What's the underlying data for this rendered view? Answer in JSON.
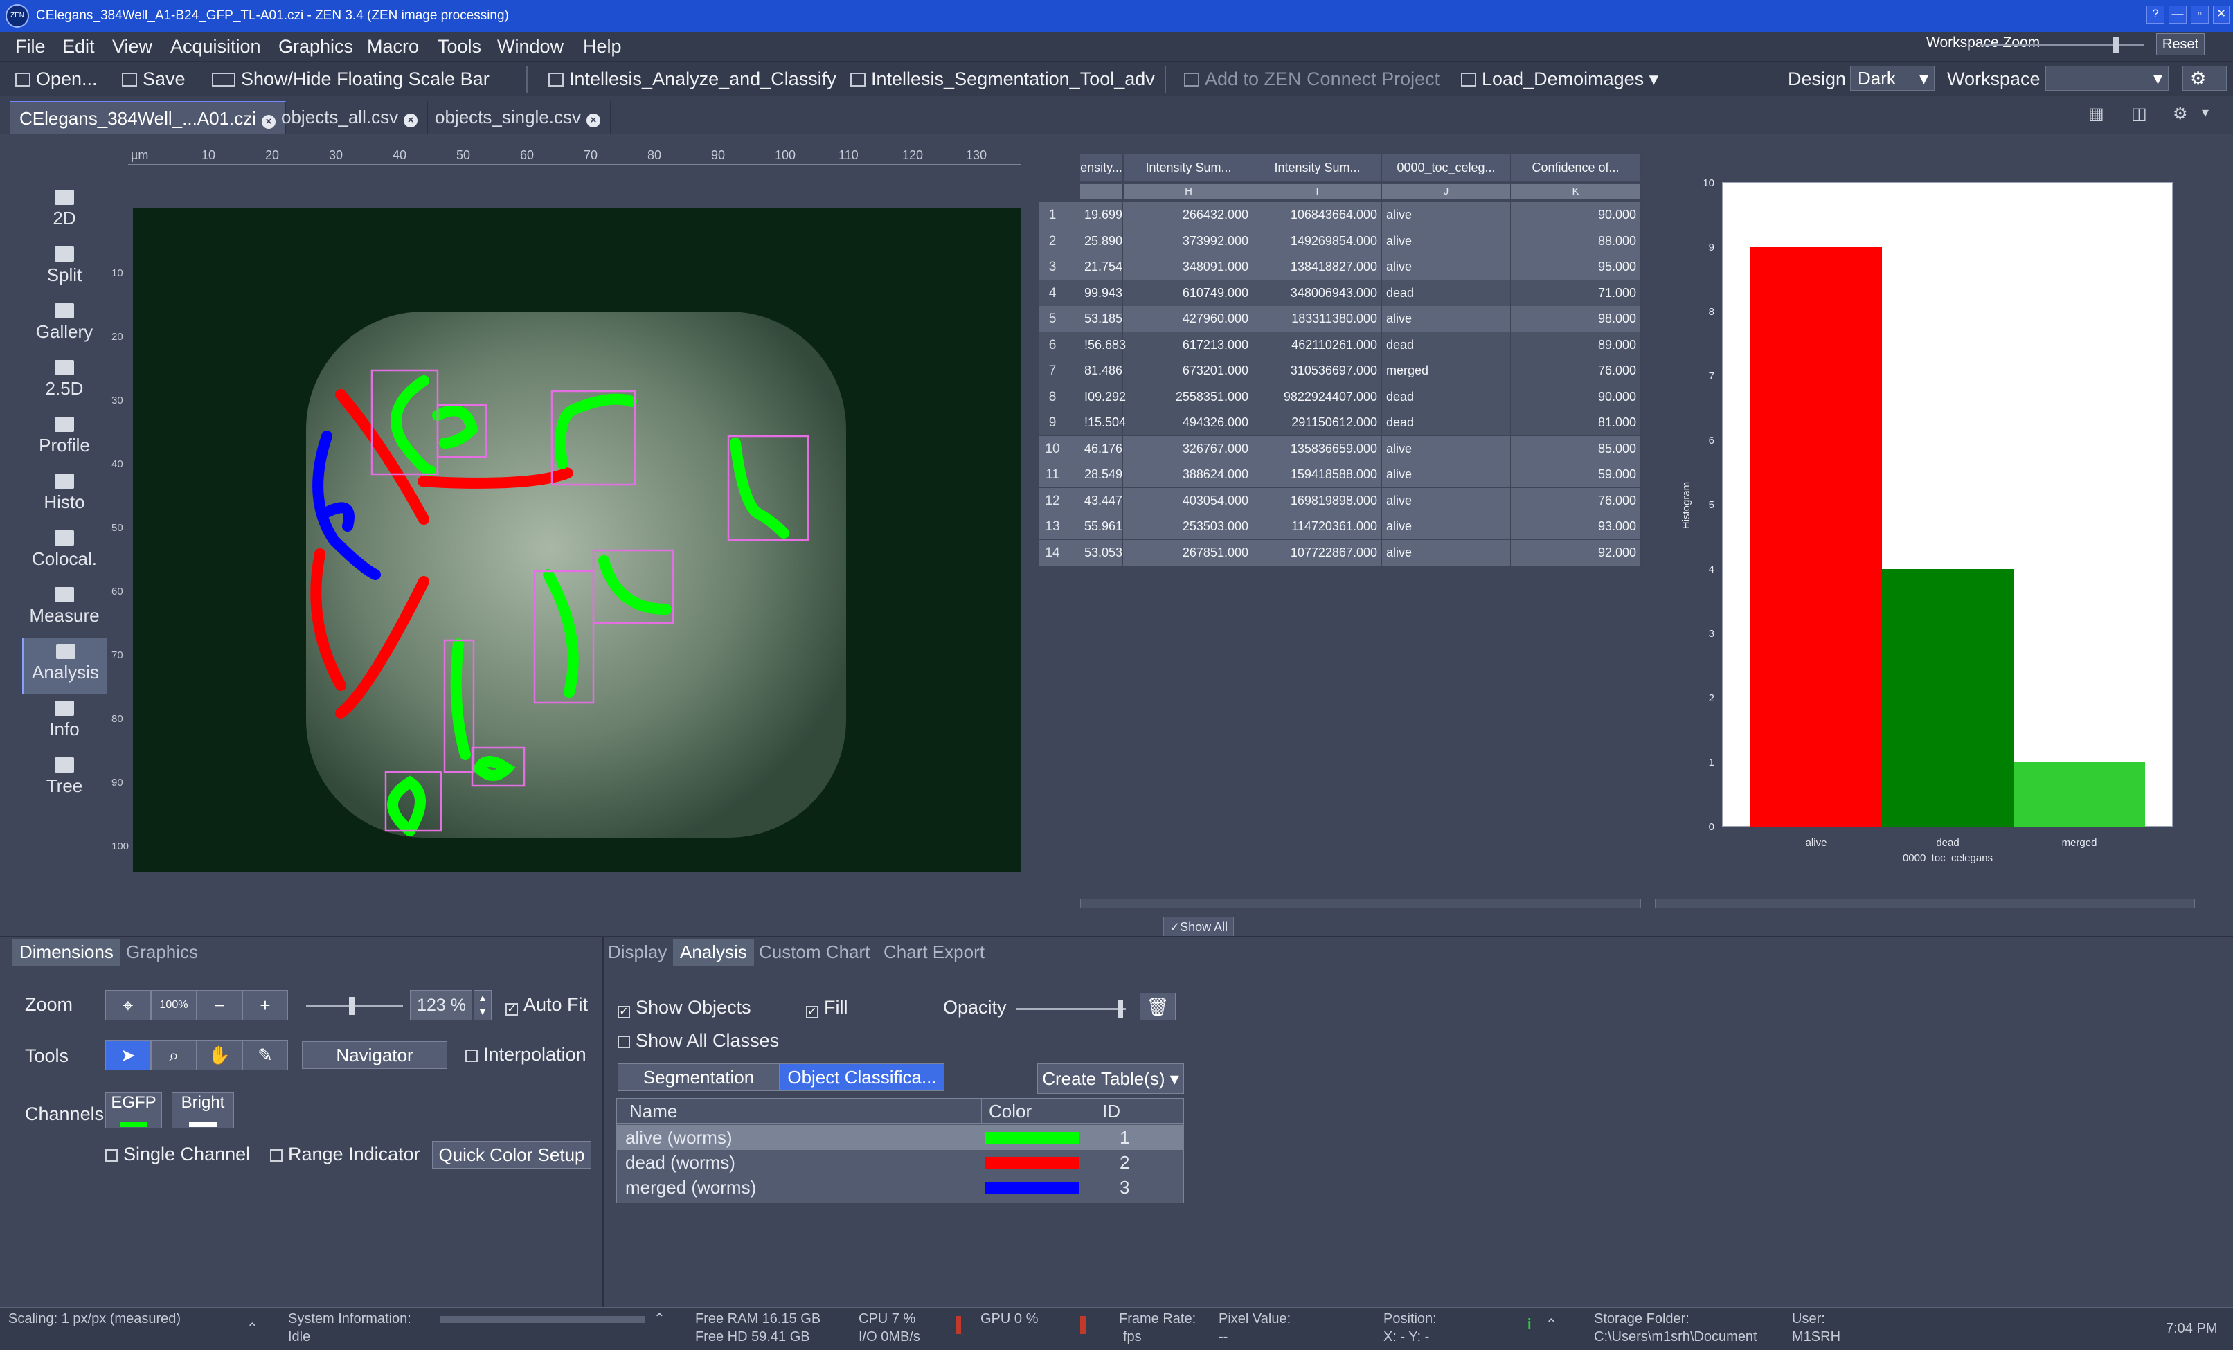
{
  "window": {
    "title": "CElegans_384Well_A1-B24_GFP_TL-A01.czi - ZEN 3.4 (ZEN image processing)",
    "app_icon_text": "ZEN",
    "workspace_zoom_label": "Workspace Zoom",
    "reset_label": "Reset",
    "controls": [
      "?",
      "—",
      "▫",
      "✕"
    ]
  },
  "menu": [
    "File",
    "Edit",
    "View",
    "Acquisition",
    "Graphics",
    "Macro",
    "Tools",
    "Window",
    "Help"
  ],
  "toolbar": {
    "open": "Open...",
    "save": "Save",
    "scale_bar": "Show/Hide Floating Scale Bar",
    "analyze": "Intellesis_Analyze_and_Classify",
    "segmentation": "Intellesis_Segmentation_Tool_adv",
    "zen_connect": "Add to ZEN Connect Project",
    "demo": "Load_Demoimages",
    "design_label": "Design",
    "design_value": "Dark",
    "workspace_label": "Workspace"
  },
  "doc_tabs": [
    "CElegans_384Well_...A01.czi",
    "objects_all.csv",
    "objects_single.csv"
  ],
  "view_modes": [
    "2D",
    "Split",
    "Gallery",
    "2.5D",
    "Profile",
    "Histo",
    "Colocal.",
    "Measure",
    "Analysis",
    "Info",
    "Tree"
  ],
  "active_view_mode": "Analysis",
  "ruler": {
    "unit": "µm",
    "ticks": [
      "10",
      "20",
      "30",
      "40",
      "50",
      "60",
      "70",
      "80",
      "90",
      "100",
      "110",
      "120",
      "130"
    ],
    "vticks": [
      "10",
      "20",
      "30",
      "40",
      "50",
      "60",
      "70",
      "80",
      "90",
      "100"
    ]
  },
  "table": {
    "headers": [
      "ensity...",
      "Intensity Sum...",
      "Intensity Sum...",
      "0000_toc_celeg...",
      "Confidence of..."
    ],
    "column_letters": [
      "",
      "H",
      "I",
      "J",
      "K"
    ],
    "rows": [
      {
        "n": "1",
        "c0": "19.699",
        "c1": "266432.000",
        "c2": "106843664.000",
        "c3": "alive",
        "c4": "90.000"
      },
      {
        "n": "2",
        "c0": "25.890",
        "c1": "373992.000",
        "c2": "149269854.000",
        "c3": "alive",
        "c4": "88.000"
      },
      {
        "n": "3",
        "c0": "21.754",
        "c1": "348091.000",
        "c2": "138418827.000",
        "c3": "alive",
        "c4": "95.000"
      },
      {
        "n": "4",
        "c0": "99.943",
        "c1": "610749.000",
        "c2": "348006943.000",
        "c3": "dead",
        "c4": "71.000"
      },
      {
        "n": "5",
        "c0": "53.185",
        "c1": "427960.000",
        "c2": "183311380.000",
        "c3": "alive",
        "c4": "98.000"
      },
      {
        "n": "6",
        "c0": "!56.683",
        "c1": "617213.000",
        "c2": "462110261.000",
        "c3": "dead",
        "c4": "89.000"
      },
      {
        "n": "7",
        "c0": "81.486",
        "c1": "673201.000",
        "c2": "310536697.000",
        "c3": "merged",
        "c4": "76.000"
      },
      {
        "n": "8",
        "c0": "I09.292",
        "c1": "2558351.000",
        "c2": "9822924407.000",
        "c3": "dead",
        "c4": "90.000"
      },
      {
        "n": "9",
        "c0": "!15.504",
        "c1": "494326.000",
        "c2": "291150612.000",
        "c3": "dead",
        "c4": "81.000"
      },
      {
        "n": "10",
        "c0": "46.176",
        "c1": "326767.000",
        "c2": "135836659.000",
        "c3": "alive",
        "c4": "85.000"
      },
      {
        "n": "11",
        "c0": "28.549",
        "c1": "388624.000",
        "c2": "159418588.000",
        "c3": "alive",
        "c4": "59.000"
      },
      {
        "n": "12",
        "c0": "43.447",
        "c1": "403054.000",
        "c2": "169819898.000",
        "c3": "alive",
        "c4": "76.000"
      },
      {
        "n": "13",
        "c0": "55.961",
        "c1": "253503.000",
        "c2": "114720361.000",
        "c3": "alive",
        "c4": "93.000"
      },
      {
        "n": "14",
        "c0": "53.053",
        "c1": "267851.000",
        "c2": "107722867.000",
        "c3": "alive",
        "c4": "92.000"
      }
    ],
    "show_all": "Show All"
  },
  "chart_data": {
    "type": "bar",
    "categories": [
      "alive",
      "dead",
      "merged"
    ],
    "values": [
      9,
      4,
      1
    ],
    "colors": [
      "#ff0000",
      "#008000",
      "#32cd32"
    ],
    "xlabel": "0000_toc_celegans",
    "ylabel": "Histogram",
    "ylim": [
      0,
      10
    ],
    "yticks": [
      "0",
      "1",
      "2",
      "3",
      "4",
      "5",
      "6",
      "7",
      "8",
      "9",
      "10"
    ]
  },
  "left_panel": {
    "tabs": [
      "Dimensions",
      "Graphics"
    ],
    "zoom_label": "Zoom",
    "zoom_value": "123 %",
    "zoom_100": "100%",
    "auto_fit": "Auto Fit",
    "tools_label": "Tools",
    "navigator": "Navigator",
    "interpolation": "Interpolation",
    "channels_label": "Channels",
    "channel_1": "EGFP",
    "channel_2": "Bright",
    "single_channel": "Single Channel",
    "range_indicator": "Range Indicator",
    "quick_color": "Quick Color Setup"
  },
  "right_panel": {
    "tabs": [
      "Display",
      "Analysis",
      "Custom Chart",
      "Chart Export"
    ],
    "show_objects": "Show Objects",
    "fill": "Fill",
    "opacity": "Opacity",
    "show_all_classes": "Show All Classes",
    "seg_tab": "Segmentation",
    "cls_tab": "Object Classifica...",
    "create_tables": "Create Table(s)",
    "table_headers": [
      "Name",
      "Color",
      "ID"
    ],
    "classes": [
      {
        "name": "alive (worms)",
        "color": "#00ff00",
        "id": "1"
      },
      {
        "name": "dead (worms)",
        "color": "#ff0000",
        "id": "2"
      },
      {
        "name": "merged (worms)",
        "color": "#0000ff",
        "id": "3"
      }
    ]
  },
  "status": {
    "scaling": "Scaling:  1 px/px (measured)",
    "sysinfo_label": "System Information:",
    "sysinfo_value": "Idle",
    "free_ram": "Free RAM  16.15 GB",
    "free_hd": "Free HD   59.41 GB",
    "cpu": "CPU  7 %",
    "io": "I/O   0MB/s",
    "gpu": "GPU  0 %",
    "frame_rate_label": "Frame Rate:",
    "frame_rate_value": "fps",
    "pixel_value_label": "Pixel Value:",
    "pixel_value_value": "--",
    "position_label": "Position:",
    "position_value": "X: -      Y: -",
    "storage_label": "Storage Folder:",
    "storage_value": "C:\\Users\\m1srh\\Document",
    "user_label": "User:",
    "user_value": "M1SRH",
    "time": "7:04 PM"
  }
}
